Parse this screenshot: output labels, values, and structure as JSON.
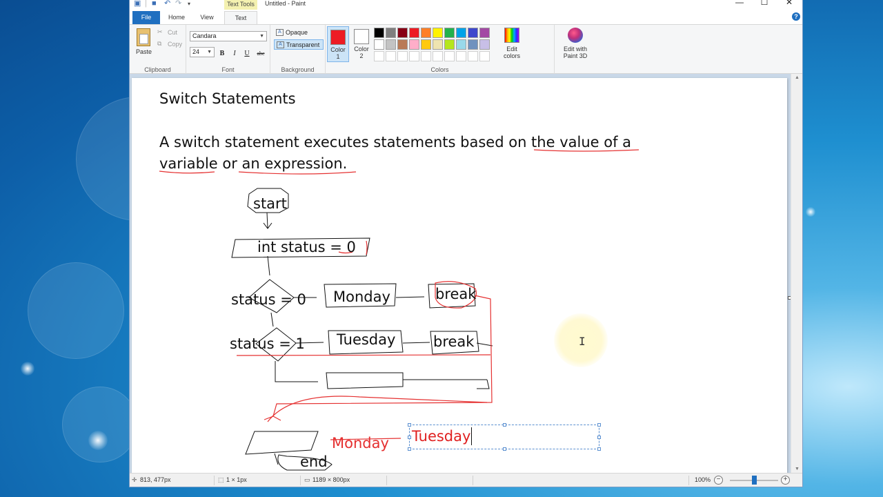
{
  "window": {
    "title": "Untitled - Paint",
    "context_tab": "Text Tools",
    "controls": {
      "minimize": "—",
      "maximize": "☐",
      "close": "✕"
    }
  },
  "tabs": {
    "file": "File",
    "home": "Home",
    "view": "View",
    "text": "Text"
  },
  "help": "?",
  "ribbon": {
    "clipboard": {
      "paste": "Paste",
      "cut": "Cut",
      "copy": "Copy",
      "label": "Clipboard"
    },
    "font": {
      "family": "Candara",
      "size": "24",
      "bold": "B",
      "italic": "I",
      "underline": "U",
      "strike": "abc",
      "label": "Font"
    },
    "background": {
      "opaque": "Opaque",
      "transparent": "Transparent",
      "label": "Background"
    },
    "colors": {
      "color1": "Color 1",
      "color1_line1": "Color",
      "color1_line2": "1",
      "color2": "Color 2",
      "color2_line1": "Color",
      "color2_line2": "2",
      "color1_value": "#ed1c24",
      "color2_value": "#ffffff",
      "edit_line1": "Edit",
      "edit_line2": "colors",
      "label": "Colors",
      "palette_row1": [
        "#000000",
        "#7f7f7f",
        "#880015",
        "#ed1c24",
        "#ff7f27",
        "#fff200",
        "#22b14c",
        "#00a2e8",
        "#3f48cc",
        "#a349a4"
      ],
      "palette_row2": [
        "#ffffff",
        "#c3c3c3",
        "#b97a57",
        "#ffaec9",
        "#ffc90e",
        "#efe4b0",
        "#b5e61d",
        "#99d9ea",
        "#7092be",
        "#c8bfe7"
      ],
      "palette_row3": [
        "#ffffff",
        "#ffffff",
        "#ffffff",
        "#ffffff",
        "#ffffff",
        "#ffffff",
        "#ffffff",
        "#ffffff",
        "#ffffff",
        "#ffffff"
      ]
    },
    "paint3d": {
      "line1": "Edit with",
      "line2": "Paint 3D"
    }
  },
  "canvas": {
    "heading": "Switch Statements",
    "desc_line1": "A switch statement executes statements based on the value of a",
    "desc_line2": "variable or an expression.",
    "flow": {
      "start": "start",
      "init": "int status = 0",
      "cond1": "status = 0",
      "case1": "Monday",
      "break1": "break",
      "cond2": "status = 1",
      "case2": "Tuesday",
      "break2": "break",
      "output_strike": "Monday",
      "end": "end"
    },
    "textbox_value": "Tuesday"
  },
  "status": {
    "cursor_pos": "813, 477px",
    "selection_size": "1 × 1px",
    "image_size": "1189 × 800px",
    "zoom": "100%",
    "zoom_minus": "−",
    "zoom_plus": "+",
    "zoom_level": 0.5
  }
}
